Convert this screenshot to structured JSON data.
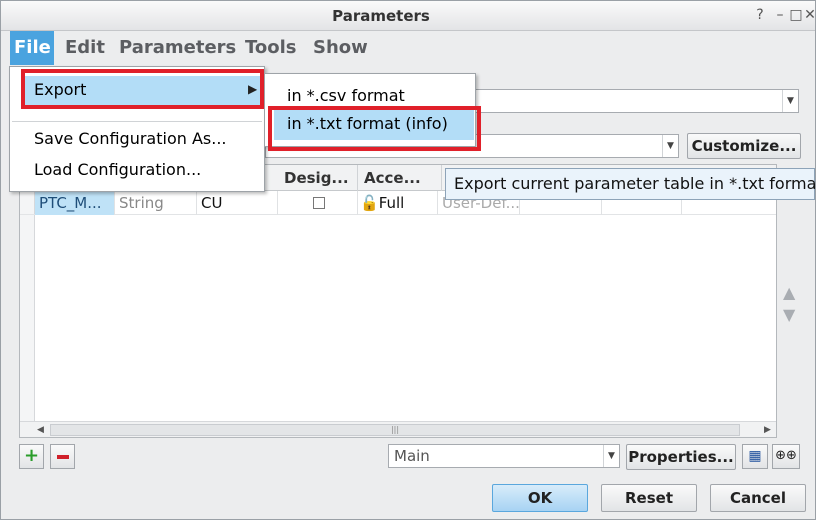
{
  "window": {
    "title": "Parameters"
  },
  "menubar": {
    "file": "File",
    "edit": "Edit",
    "parameters": "Parameters",
    "tools": "Tools",
    "show": "Show"
  },
  "file_menu": {
    "export": "Export",
    "save_configuration": "Save Configuration As...",
    "load_configuration": "Load Configuration..."
  },
  "export_submenu": {
    "csv": "in *.csv format",
    "txt": "in *.txt format (info)"
  },
  "tooltip": "Export current parameter table in *.txt format.",
  "toolbar": {
    "customize": "Customize..."
  },
  "table": {
    "headers": {
      "designate": "Desig...",
      "access": "Acce..."
    },
    "rows": [
      {
        "name": "PTC_M...",
        "type": "String",
        "value": "CU",
        "access": "Full",
        "source": "User-Def..."
      }
    ]
  },
  "bottom": {
    "filter_value": "Main",
    "properties": "Properties..."
  },
  "buttons": {
    "ok": "OK",
    "reset": "Reset",
    "cancel": "Cancel"
  },
  "colors": {
    "highlight_border": "#e0202a",
    "selection": "#b3ddf7",
    "menu_active": "#4aa3df"
  }
}
